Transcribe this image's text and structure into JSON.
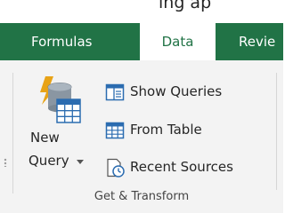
{
  "ribbon_tabs": {
    "formulas": "Formulas",
    "data": "Data",
    "review": "Revie"
  },
  "top_strip": {
    "partial_text": "ing ap"
  },
  "get_transform": {
    "new_query": {
      "line1": "New",
      "line2": "Query"
    },
    "commands": {
      "show_queries": "Show Queries",
      "from_table": "From Table",
      "recent_sources": "Recent Sources"
    },
    "group_label": "Get & Transform"
  },
  "colors": {
    "tab_bar": "#217346",
    "ribbon_bg": "#f3f3f3",
    "icon_blue": "#2b6cb0",
    "icon_gold": "#e8a317"
  },
  "icons": {
    "new_query": "database-with-lightning-icon",
    "show_queries": "queries-pane-icon",
    "from_table": "table-grid-icon",
    "recent_sources": "recent-sources-clock-icon",
    "dropdown": "dropdown-caret-icon"
  }
}
